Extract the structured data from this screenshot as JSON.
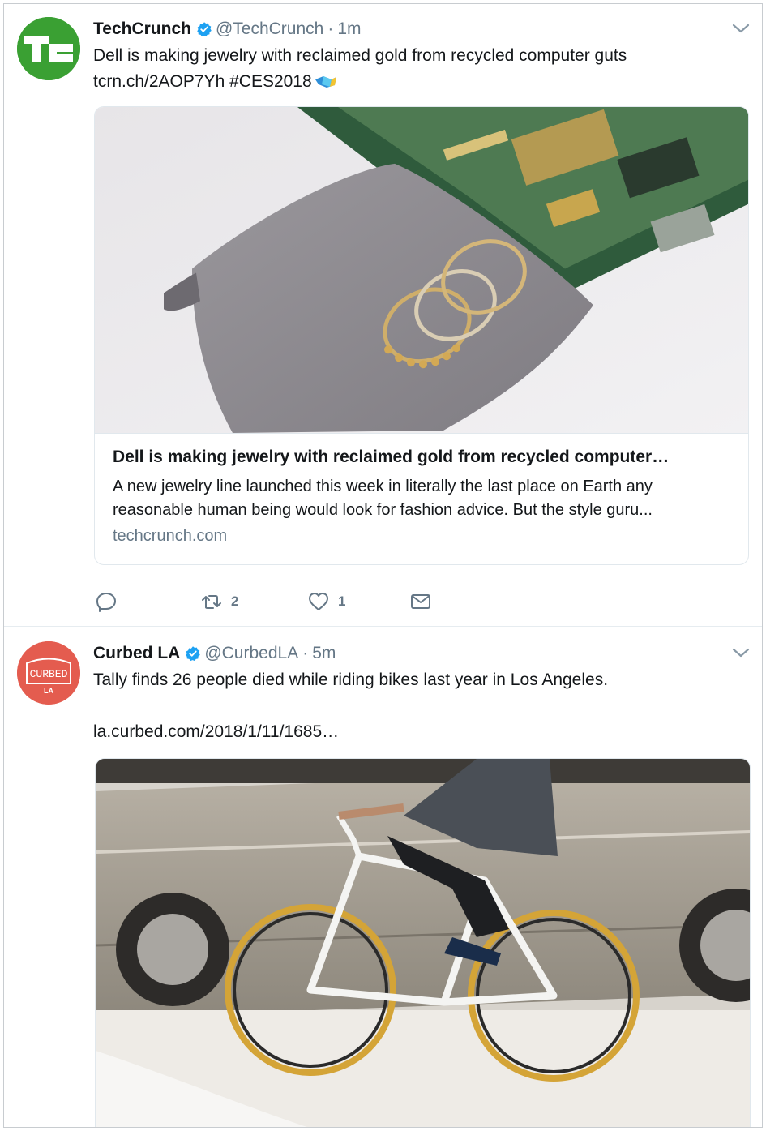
{
  "tweets": [
    {
      "name": "TechCrunch",
      "handle": "@TechCrunch",
      "separator": "·",
      "time": "1m",
      "text_line1": "Dell is making jewelry with reclaimed gold from recycled computer guts",
      "link": "tcrn.ch/2AOP7Yh",
      "hashtag": "#CES2018",
      "card": {
        "title": "Dell is making jewelry with reclaimed gold from recycled computer…",
        "description": "A new jewelry line launched this week in literally the last place on Earth any reasonable human being would look for fashion advice. But the style guru...",
        "domain": "techcrunch.com"
      },
      "actions": {
        "reply_count": "",
        "retweet_count": "2",
        "like_count": "1"
      }
    },
    {
      "name": "Curbed LA",
      "handle": "@CurbedLA",
      "separator": "·",
      "time": "5m",
      "text_line1": "Tally finds 26 people died while riding bikes last year in Los Angeles.",
      "link": "la.curbed.com/2018/1/11/1685…",
      "avatar_text_top": "CURBED",
      "avatar_text_bottom": "LA"
    }
  ],
  "colors": {
    "techcrunch_green": "#3aa033",
    "curbed_red": "#e45c4f",
    "verified_blue": "#1da1f2",
    "secondary_text": "#657786"
  },
  "icons": [
    "techcrunch-logo",
    "verified-badge-icon",
    "chevron-down-icon",
    "reply-icon",
    "retweet-icon",
    "like-icon",
    "direct-message-icon",
    "ces-flag-emoji",
    "curbed-la-logo"
  ]
}
